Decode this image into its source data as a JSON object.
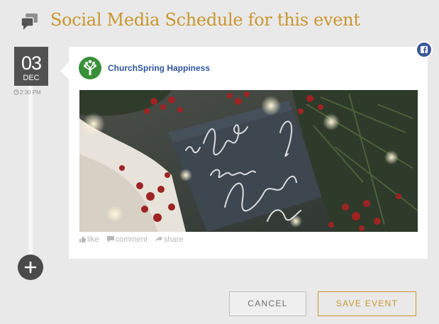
{
  "header": {
    "title": "Social Media Schedule for this event",
    "icon": "chat-bubbles-icon"
  },
  "schedule": {
    "day": "03",
    "month": "DEC",
    "time": "2:30 PM"
  },
  "post": {
    "platform": "facebook",
    "account_name": "ChurchSpring Happiness",
    "image_script_text": "In Christ alone my Hope is found",
    "actions": {
      "like": "like",
      "comment": "comment",
      "share": "share"
    }
  },
  "buttons": {
    "cancel": "CANCEL",
    "save": "SAVE EVENT"
  },
  "colors": {
    "accent": "#c9962e",
    "facebook": "#3b5998",
    "date_bg": "#515151",
    "background": "#e9e9e9"
  }
}
